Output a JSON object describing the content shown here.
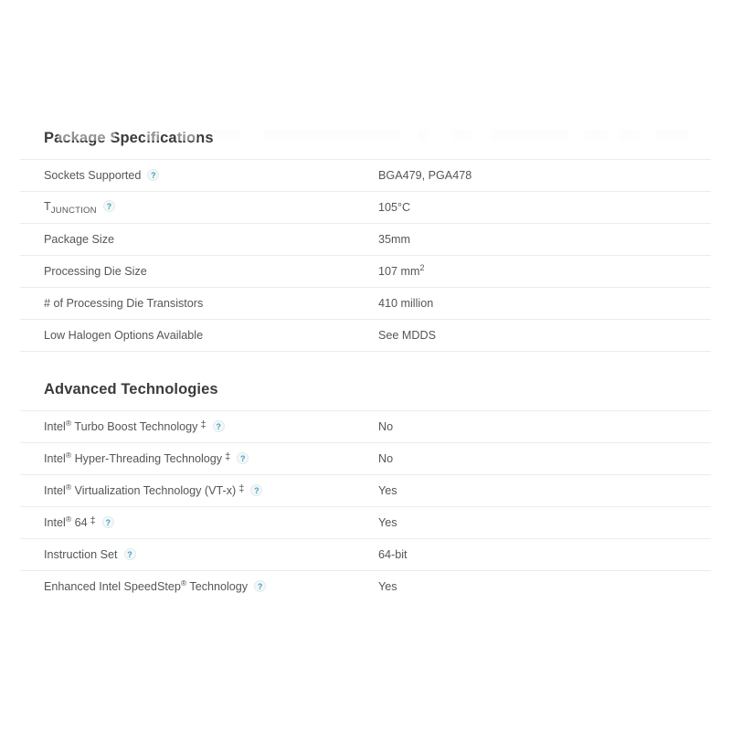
{
  "sections": [
    {
      "title": "Package Specifications",
      "rows": [
        {
          "label": "Sockets Supported",
          "help": true,
          "value": "BGA479, PGA478"
        },
        {
          "label": "TJUNCTION",
          "label_type": "subscript",
          "label_main": "T",
          "label_sub": "JUNCTION",
          "help": true,
          "value": "105°C"
        },
        {
          "label": "Package Size",
          "help": false,
          "value": "35mm"
        },
        {
          "label": "Processing Die Size",
          "help": false,
          "value": "107 mm2",
          "value_type": "superscript",
          "value_main": "107 mm",
          "value_sup": "2"
        },
        {
          "label": "# of Processing Die Transistors",
          "help": false,
          "value": "410 million"
        },
        {
          "label": "Low Halogen Options Available",
          "help": false,
          "value": "See MDDS"
        }
      ]
    },
    {
      "title": "Advanced Technologies",
      "rows": [
        {
          "label": "Intel® Turbo Boost Technology",
          "label_type": "registered",
          "label_main": "Intel",
          "label_rest": " Turbo Boost Technology",
          "dagger": "‡",
          "help": true,
          "value": "No"
        },
        {
          "label": "Intel® Hyper-Threading Technology",
          "label_type": "registered",
          "label_main": "Intel",
          "label_rest": " Hyper-Threading Technology",
          "dagger": "‡",
          "help": true,
          "value": "No"
        },
        {
          "label": "Intel® Virtualization Technology (VT-x)",
          "label_type": "registered",
          "label_main": "Intel",
          "label_rest": " Virtualization Technology (VT-x)",
          "dagger": "‡",
          "help": true,
          "value": "Yes"
        },
        {
          "label": "Intel® 64",
          "label_type": "registered",
          "label_main": "Intel",
          "label_rest": " 64",
          "dagger": "‡",
          "help": true,
          "value": "Yes"
        },
        {
          "label": "Instruction Set",
          "help": true,
          "value": "64-bit"
        },
        {
          "label": "Enhanced Intel SpeedStep® Technology",
          "label_type": "registered_mid",
          "label_main": "Enhanced Intel SpeedStep",
          "label_rest": " Technology",
          "help": true,
          "value": "Yes"
        }
      ]
    }
  ],
  "icons": {
    "help_glyph": "?",
    "registered_glyph": "®",
    "dagger_glyph": "‡"
  },
  "colors": {
    "heading": "#3b3b3b",
    "text": "#53565a",
    "divider": "#ececec",
    "help_accent": "#3aa5bd",
    "background": "#ffffff"
  }
}
